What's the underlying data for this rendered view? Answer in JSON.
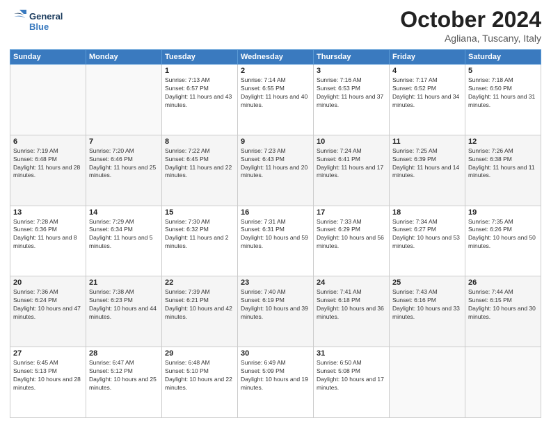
{
  "header": {
    "logo_line1": "General",
    "logo_line2": "Blue",
    "month_year": "October 2024",
    "location": "Agliana, Tuscany, Italy"
  },
  "weekdays": [
    "Sunday",
    "Monday",
    "Tuesday",
    "Wednesday",
    "Thursday",
    "Friday",
    "Saturday"
  ],
  "weeks": [
    [
      {
        "day": "",
        "sunrise": "",
        "sunset": "",
        "daylight": ""
      },
      {
        "day": "",
        "sunrise": "",
        "sunset": "",
        "daylight": ""
      },
      {
        "day": "1",
        "sunrise": "Sunrise: 7:13 AM",
        "sunset": "Sunset: 6:57 PM",
        "daylight": "Daylight: 11 hours and 43 minutes."
      },
      {
        "day": "2",
        "sunrise": "Sunrise: 7:14 AM",
        "sunset": "Sunset: 6:55 PM",
        "daylight": "Daylight: 11 hours and 40 minutes."
      },
      {
        "day": "3",
        "sunrise": "Sunrise: 7:16 AM",
        "sunset": "Sunset: 6:53 PM",
        "daylight": "Daylight: 11 hours and 37 minutes."
      },
      {
        "day": "4",
        "sunrise": "Sunrise: 7:17 AM",
        "sunset": "Sunset: 6:52 PM",
        "daylight": "Daylight: 11 hours and 34 minutes."
      },
      {
        "day": "5",
        "sunrise": "Sunrise: 7:18 AM",
        "sunset": "Sunset: 6:50 PM",
        "daylight": "Daylight: 11 hours and 31 minutes."
      }
    ],
    [
      {
        "day": "6",
        "sunrise": "Sunrise: 7:19 AM",
        "sunset": "Sunset: 6:48 PM",
        "daylight": "Daylight: 11 hours and 28 minutes."
      },
      {
        "day": "7",
        "sunrise": "Sunrise: 7:20 AM",
        "sunset": "Sunset: 6:46 PM",
        "daylight": "Daylight: 11 hours and 25 minutes."
      },
      {
        "day": "8",
        "sunrise": "Sunrise: 7:22 AM",
        "sunset": "Sunset: 6:45 PM",
        "daylight": "Daylight: 11 hours and 22 minutes."
      },
      {
        "day": "9",
        "sunrise": "Sunrise: 7:23 AM",
        "sunset": "Sunset: 6:43 PM",
        "daylight": "Daylight: 11 hours and 20 minutes."
      },
      {
        "day": "10",
        "sunrise": "Sunrise: 7:24 AM",
        "sunset": "Sunset: 6:41 PM",
        "daylight": "Daylight: 11 hours and 17 minutes."
      },
      {
        "day": "11",
        "sunrise": "Sunrise: 7:25 AM",
        "sunset": "Sunset: 6:39 PM",
        "daylight": "Daylight: 11 hours and 14 minutes."
      },
      {
        "day": "12",
        "sunrise": "Sunrise: 7:26 AM",
        "sunset": "Sunset: 6:38 PM",
        "daylight": "Daylight: 11 hours and 11 minutes."
      }
    ],
    [
      {
        "day": "13",
        "sunrise": "Sunrise: 7:28 AM",
        "sunset": "Sunset: 6:36 PM",
        "daylight": "Daylight: 11 hours and 8 minutes."
      },
      {
        "day": "14",
        "sunrise": "Sunrise: 7:29 AM",
        "sunset": "Sunset: 6:34 PM",
        "daylight": "Daylight: 11 hours and 5 minutes."
      },
      {
        "day": "15",
        "sunrise": "Sunrise: 7:30 AM",
        "sunset": "Sunset: 6:32 PM",
        "daylight": "Daylight: 11 hours and 2 minutes."
      },
      {
        "day": "16",
        "sunrise": "Sunrise: 7:31 AM",
        "sunset": "Sunset: 6:31 PM",
        "daylight": "Daylight: 10 hours and 59 minutes."
      },
      {
        "day": "17",
        "sunrise": "Sunrise: 7:33 AM",
        "sunset": "Sunset: 6:29 PM",
        "daylight": "Daylight: 10 hours and 56 minutes."
      },
      {
        "day": "18",
        "sunrise": "Sunrise: 7:34 AM",
        "sunset": "Sunset: 6:27 PM",
        "daylight": "Daylight: 10 hours and 53 minutes."
      },
      {
        "day": "19",
        "sunrise": "Sunrise: 7:35 AM",
        "sunset": "Sunset: 6:26 PM",
        "daylight": "Daylight: 10 hours and 50 minutes."
      }
    ],
    [
      {
        "day": "20",
        "sunrise": "Sunrise: 7:36 AM",
        "sunset": "Sunset: 6:24 PM",
        "daylight": "Daylight: 10 hours and 47 minutes."
      },
      {
        "day": "21",
        "sunrise": "Sunrise: 7:38 AM",
        "sunset": "Sunset: 6:23 PM",
        "daylight": "Daylight: 10 hours and 44 minutes."
      },
      {
        "day": "22",
        "sunrise": "Sunrise: 7:39 AM",
        "sunset": "Sunset: 6:21 PM",
        "daylight": "Daylight: 10 hours and 42 minutes."
      },
      {
        "day": "23",
        "sunrise": "Sunrise: 7:40 AM",
        "sunset": "Sunset: 6:19 PM",
        "daylight": "Daylight: 10 hours and 39 minutes."
      },
      {
        "day": "24",
        "sunrise": "Sunrise: 7:41 AM",
        "sunset": "Sunset: 6:18 PM",
        "daylight": "Daylight: 10 hours and 36 minutes."
      },
      {
        "day": "25",
        "sunrise": "Sunrise: 7:43 AM",
        "sunset": "Sunset: 6:16 PM",
        "daylight": "Daylight: 10 hours and 33 minutes."
      },
      {
        "day": "26",
        "sunrise": "Sunrise: 7:44 AM",
        "sunset": "Sunset: 6:15 PM",
        "daylight": "Daylight: 10 hours and 30 minutes."
      }
    ],
    [
      {
        "day": "27",
        "sunrise": "Sunrise: 6:45 AM",
        "sunset": "Sunset: 5:13 PM",
        "daylight": "Daylight: 10 hours and 28 minutes."
      },
      {
        "day": "28",
        "sunrise": "Sunrise: 6:47 AM",
        "sunset": "Sunset: 5:12 PM",
        "daylight": "Daylight: 10 hours and 25 minutes."
      },
      {
        "day": "29",
        "sunrise": "Sunrise: 6:48 AM",
        "sunset": "Sunset: 5:10 PM",
        "daylight": "Daylight: 10 hours and 22 minutes."
      },
      {
        "day": "30",
        "sunrise": "Sunrise: 6:49 AM",
        "sunset": "Sunset: 5:09 PM",
        "daylight": "Daylight: 10 hours and 19 minutes."
      },
      {
        "day": "31",
        "sunrise": "Sunrise: 6:50 AM",
        "sunset": "Sunset: 5:08 PM",
        "daylight": "Daylight: 10 hours and 17 minutes."
      },
      {
        "day": "",
        "sunrise": "",
        "sunset": "",
        "daylight": ""
      },
      {
        "day": "",
        "sunrise": "",
        "sunset": "",
        "daylight": ""
      }
    ]
  ]
}
